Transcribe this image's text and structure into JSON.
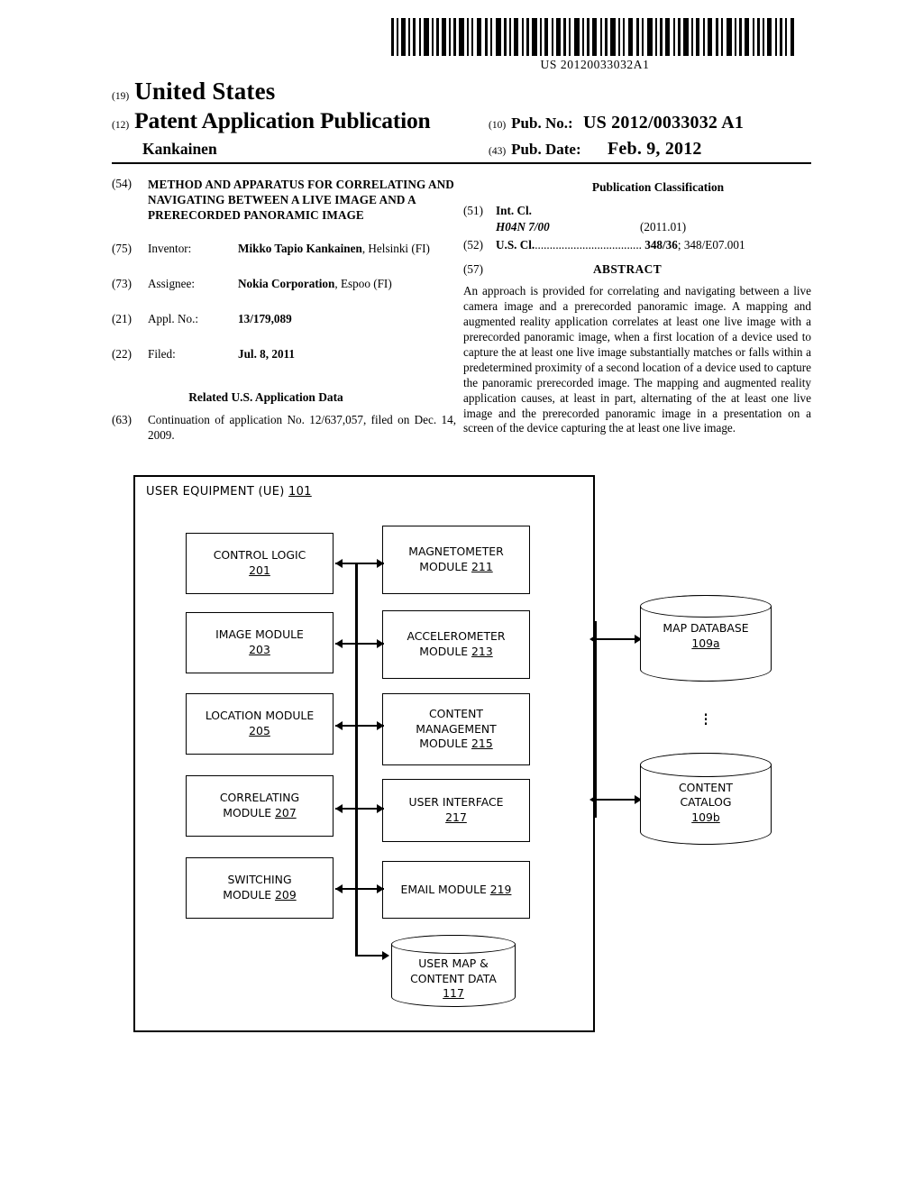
{
  "barcode": {
    "publication_number_text": "US 20120033032A1",
    "icon": "barcode"
  },
  "masthead": {
    "code_19": "(19)",
    "country": "United States",
    "code_12": "(12)",
    "doc_type": "Patent Application Publication",
    "inventor_surname": "Kankainen",
    "code_10": "(10)",
    "pub_no_label": "Pub. No.:",
    "pub_no_value": "US 2012/0033032 A1",
    "code_43": "(43)",
    "pub_date_label": "Pub. Date:",
    "pub_date_value": "Feb. 9, 2012"
  },
  "left_column": {
    "title_code": "(54)",
    "title": "METHOD AND APPARATUS FOR CORRELATING AND NAVIGATING BETWEEN A LIVE IMAGE AND A PRERECORDED PANORAMIC IMAGE",
    "fields": [
      {
        "code": "(75)",
        "label": "Inventor:",
        "value_bold": "Mikko Tapio Kankainen",
        "value_rest": ", Helsinki (FI)"
      },
      {
        "code": "(73)",
        "label": "Assignee:",
        "value_bold": "Nokia Corporation",
        "value_rest": ", Espoo (FI)"
      },
      {
        "code": "(21)",
        "label": "Appl. No.:",
        "value_bold": "13/179,089",
        "value_rest": ""
      },
      {
        "code": "(22)",
        "label": "Filed:",
        "value_bold": "Jul. 8, 2011",
        "value_rest": ""
      }
    ],
    "related_heading": "Related U.S. Application Data",
    "related_code": "(63)",
    "related_text": "Continuation of application No. 12/637,057, filed on Dec. 14, 2009."
  },
  "right_column": {
    "classification_heading": "Publication Classification",
    "int_cl_code": "(51)",
    "int_cl_label": "Int. Cl.",
    "int_cl_symbol": "H04N 7/00",
    "int_cl_version": "(2011.01)",
    "us_cl_code": "(52)",
    "us_cl_label": "U.S. Cl.",
    "us_cl_leader": "....................................",
    "us_cl_value_bold": "348/36",
    "us_cl_value_rest": "; 348/E07.001",
    "abstract_code": "(57)",
    "abstract_heading": "ABSTRACT",
    "abstract_text": "An approach is provided for correlating and navigating between a live camera image and a prerecorded panoramic image. A mapping and augmented reality application correlates at least one live image with a prerecorded panoramic image, when a first location of a device used to capture the at least one live image substantially matches or falls within a predetermined proximity of a second location of a device used to capture the panoramic prerecorded image. The mapping and augmented reality application causes, at least in part, alternating of the at least one live image and the prerecorded panoramic image in a presentation on a screen of the device capturing the at least one live image."
  },
  "figure": {
    "container_label": "USER EQUIPMENT (UE)",
    "container_ref": "101",
    "modules": [
      {
        "name": "CONTROL LOGIC",
        "ref": "201",
        "lines": [
          "CONTROL LOGIC"
        ]
      },
      {
        "name": "IMAGE MODULE",
        "ref": "203",
        "lines": [
          "IMAGE MODULE"
        ]
      },
      {
        "name": "LOCATION MODULE",
        "ref": "205",
        "lines": [
          "LOCATION MODULE"
        ]
      },
      {
        "name": "CORRELATING MODULE",
        "ref": "207",
        "lines": [
          "CORRELATING",
          "MODULE"
        ]
      },
      {
        "name": "SWITCHING MODULE",
        "ref": "209",
        "lines": [
          "SWITCHING",
          "MODULE"
        ]
      },
      {
        "name": "MAGNETOMETER MODULE",
        "ref": "211",
        "lines": [
          "MAGNETOMETER",
          "MODULE"
        ]
      },
      {
        "name": "ACCELEROMETER MODULE",
        "ref": "213",
        "lines": [
          "ACCELEROMETER",
          "MODULE"
        ]
      },
      {
        "name": "CONTENT MANAGEMENT MODULE",
        "ref": "215",
        "lines": [
          "CONTENT",
          "MANAGEMENT",
          "MODULE"
        ]
      },
      {
        "name": "USER INTERFACE",
        "ref": "217",
        "lines": [
          "USER INTERFACE"
        ]
      },
      {
        "name": "EMAIL MODULE",
        "ref": "219",
        "lines": [
          "EMAIL MODULE"
        ]
      }
    ],
    "module_text": {
      "control_logic_l1": "CONTROL LOGIC",
      "control_logic_ref": "201",
      "image_module_l1": "IMAGE MODULE",
      "image_module_ref": "203",
      "location_module_l1": "LOCATION MODULE",
      "location_module_ref": "205",
      "correlating_l1": "CORRELATING",
      "correlating_l2": "MODULE",
      "correlating_ref": "207",
      "switching_l1": "SWITCHING",
      "switching_l2": "MODULE",
      "switching_ref": "209",
      "magnetometer_l1": "MAGNETOMETER",
      "magnetometer_l2": "MODULE",
      "magnetometer_ref": "211",
      "accelerometer_l1": "ACCELEROMETER",
      "accelerometer_l2": "MODULE",
      "accelerometer_ref": "213",
      "content_mgmt_l1": "CONTENT",
      "content_mgmt_l2": "MANAGEMENT",
      "content_mgmt_l3": "MODULE",
      "content_mgmt_ref": "215",
      "user_interface_l1": "USER INTERFACE",
      "user_interface_ref": "217",
      "email_l1": "EMAIL MODULE",
      "email_ref": "219"
    },
    "datastores": {
      "user_map_l1": "USER MAP &",
      "user_map_l2": "CONTENT DATA",
      "user_map_ref": "117",
      "map_db_l1": "MAP DATABASE",
      "map_db_ref": "109a",
      "content_catalog_l1": "CONTENT",
      "content_catalog_l2": "CATALOG",
      "content_catalog_ref": "109b",
      "ellipsis": "⋮"
    }
  }
}
